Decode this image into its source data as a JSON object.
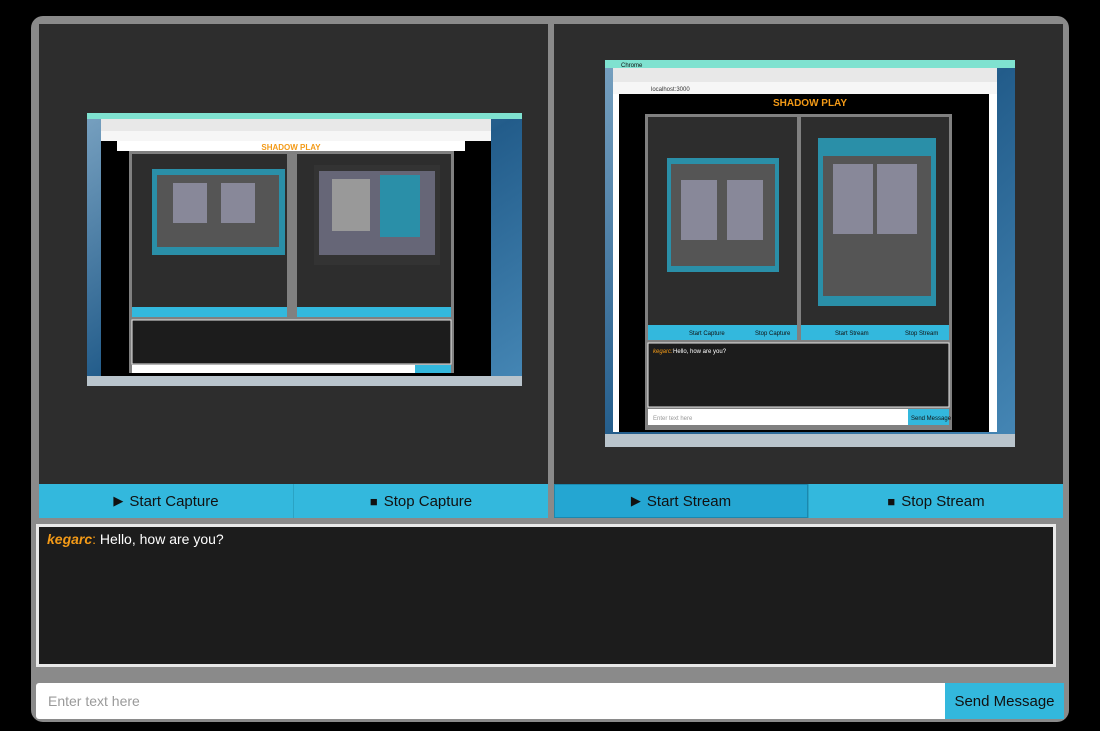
{
  "left_panel": {
    "start_label": "Start Capture",
    "stop_label": "Stop Capture",
    "start_icon": "play-icon",
    "stop_icon": "stop-icon"
  },
  "right_panel": {
    "start_label": "Start Stream",
    "stop_label": "Stop Stream",
    "start_icon": "play-icon",
    "stop_icon": "stop-icon",
    "active_button": "start"
  },
  "chat": {
    "messages": [
      {
        "user": "kegarc",
        "separator": ":",
        "text": " Hello, how are you?"
      }
    ]
  },
  "input": {
    "placeholder": "Enter text here",
    "value": ""
  },
  "send_label": "Send Message",
  "mirror": {
    "app_title": "SHADOW PLAY",
    "browser_url": "localhost:3000",
    "menu_app": "Chrome",
    "chat_user": "kegarc:",
    "chat_text": "Hello, how are you?",
    "input_placeholder": "Enter text here",
    "send_label": "Send Message",
    "left_start": "Start Capture",
    "left_stop": "Stop Capture",
    "right_start": "Start Stream",
    "right_stop": "Stop Stream"
  },
  "colors": {
    "accent": "#33b8dd",
    "panel": "#2d2d2d",
    "chat_bg": "#1c1c1c",
    "username": "#f39a17",
    "frame": "#8a8a8a"
  }
}
